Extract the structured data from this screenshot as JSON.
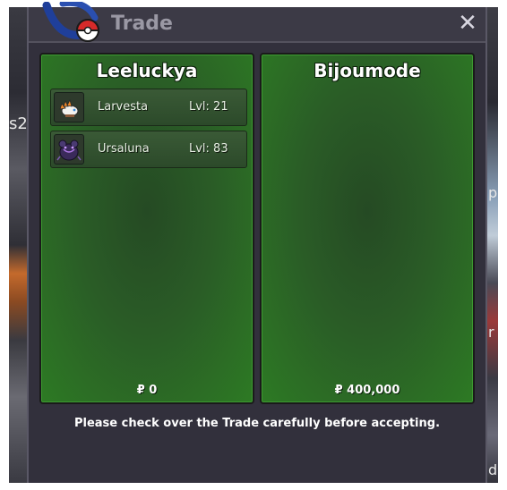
{
  "window": {
    "title": "Trade",
    "close_label": "✕"
  },
  "background": {
    "left_text": "s2",
    "right_texts": [
      "p",
      "r",
      "d"
    ]
  },
  "left_panel": {
    "player": "Leeluckya",
    "money": "₽ 0",
    "pokemon": [
      {
        "name": "Larvesta",
        "level": "Lvl: 21",
        "icon": "larvesta-sprite-icon"
      },
      {
        "name": "Ursaluna",
        "level": "Lvl: 83",
        "icon": "ursaluna-sprite-icon"
      }
    ]
  },
  "right_panel": {
    "player": "Bijoumode",
    "money": "₽ 400,000",
    "pokemon": []
  },
  "notice": "Please check over the Trade carefully before accepting.",
  "colors": {
    "window_bg": "#32303c",
    "panel_green": "#2d7a24",
    "title_gray": "#9a98a4"
  }
}
